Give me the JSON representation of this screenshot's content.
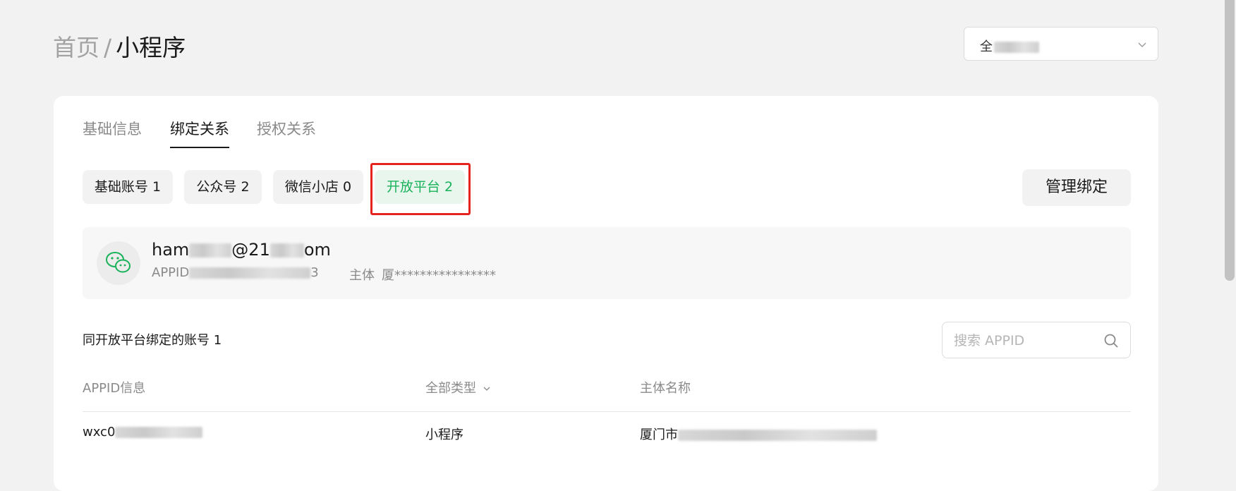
{
  "breadcrumb": {
    "home": "首页",
    "separator": "/",
    "current": "小程序"
  },
  "account_select": {
    "value_prefix": "全"
  },
  "tabs": [
    {
      "label": "基础信息",
      "active": false
    },
    {
      "label": "绑定关系",
      "active": true
    },
    {
      "label": "授权关系",
      "active": false
    }
  ],
  "chips": [
    {
      "label": "基础账号 1",
      "active": false
    },
    {
      "label": "公众号 2",
      "active": false
    },
    {
      "label": "微信小店 0",
      "active": false
    },
    {
      "label": "开放平台 2",
      "active": true
    }
  ],
  "manage_button": "管理绑定",
  "platform": {
    "email_start": "ham",
    "email_mid": "@21",
    "email_end": "om",
    "appid_label": "APPID",
    "appid_end": "3",
    "subject_label": "主体",
    "subject_value": "厦****************"
  },
  "bound": {
    "title": "同开放平台绑定的账号 1",
    "search_placeholder": "搜索 APPID",
    "columns": {
      "appid": "APPID信息",
      "type": "全部类型",
      "subject": "主体名称"
    },
    "rows": [
      {
        "appid_prefix": "wxc0",
        "type": "小程序",
        "subject_prefix": "厦门市"
      }
    ]
  },
  "colors": {
    "accent_green": "#19b25a",
    "highlight_red": "#e5221d"
  }
}
